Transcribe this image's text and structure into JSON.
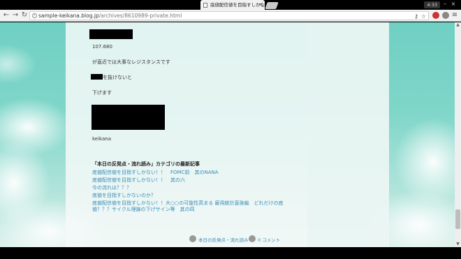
{
  "browser": {
    "tab_title": "底値配信値を目指すしかない",
    "tab_close": "✕",
    "clock": "4:33",
    "url_host": "sample-keikana.blog.jp",
    "url_path": "/archives/8610989-private.html"
  },
  "post": {
    "line_value": "107.680",
    "line1": "が直近では大事なレジスタンスです",
    "line2": "を抜けないと",
    "line3": "下げます",
    "author": "keikana"
  },
  "related": {
    "heading": "「本日の反発点・流れ読み」カテゴリの最新記事",
    "links": [
      "底値配信値を目指すしかない！！　FOMC前　其のNANA",
      "底値配信値を目指すしかない！！　其の六",
      "今の流れは？？？",
      "底値を目指すしかないのか？",
      "底値配信値を目指すしかない！！大○○の可能性高まる 雇用統計直後編　どれだけの底",
      "値？？？サイクル理論の下げサイン等　其の四"
    ]
  },
  "footer": {
    "category": "本日の反発点・流れ読み",
    "comments": "0 コメント"
  }
}
